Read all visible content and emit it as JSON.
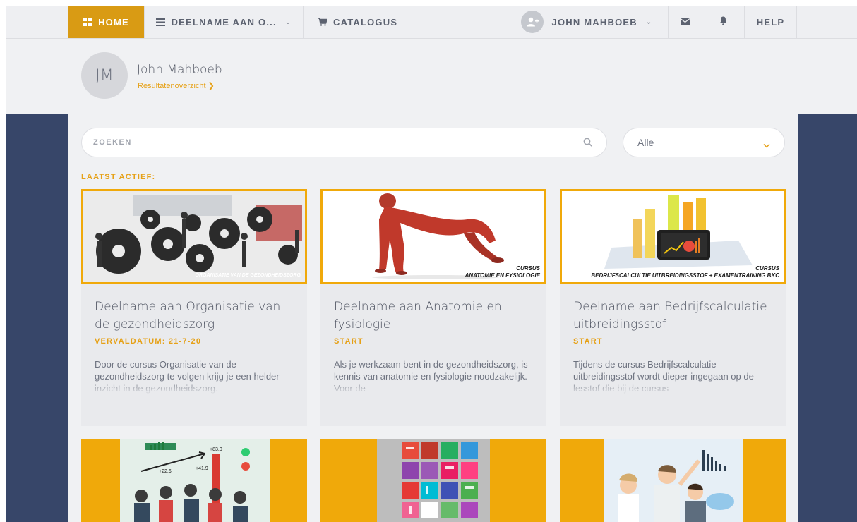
{
  "nav": {
    "home": "HOME",
    "deelname": "DEELNAME AAN O...",
    "catalogus": "CATALOGUS",
    "user": "JOHN MAHBOEB",
    "help": "HELP"
  },
  "profile": {
    "initials": "JM",
    "name": "John Mahboeb",
    "link": "Resultatenoverzicht"
  },
  "search": {
    "placeholder": "ZOEKEN"
  },
  "filter": {
    "selected": "Alle"
  },
  "section_label": "LAATST ACTIEF:",
  "cards": [
    {
      "title": "Deelname aan Organisatie van de gezondheidszorg",
      "status": "VERVALDATUM: 21-7-20",
      "description": "Door de cursus Organisatie van de gezondheidszorg te volgen krijg je een helder inzicht in de gezondheidszorg.",
      "caption": "ORGANISATIE VAN DE GEZONDHEIDSZORG"
    },
    {
      "title": "Deelname aan Anatomie en fysiologie",
      "status": "START",
      "description": "Als je werkzaam bent in de gezondheidszorg, is kennis van anatomie en fysiologie noodzakelijk. Voor de",
      "caption_top": "CURSUS",
      "caption_bottom": "ANATOMIE EN FYSIOLOGIE"
    },
    {
      "title": "Deelname aan Bedrijfscalculatie uitbreidingsstof",
      "status": "START",
      "description": "Tijdens de cursus Bedrijfscalculatie uitbreidingsstof wordt dieper ingegaan op de lesstof die bij de cursus",
      "caption_top": "CURSUS",
      "caption_bottom": "BEDRIJFSCALCULTIE UITBREIDINGSSTOF + EXAMENTRAINING BKC"
    }
  ],
  "chart_thumb_labels": [
    "+83.0",
    "+41.9",
    "+22.6"
  ],
  "colors": {
    "accent": "#e6a117",
    "nav_active": "#d99b14",
    "sidebar": "#374669",
    "card_border": "#f0a90a"
  }
}
